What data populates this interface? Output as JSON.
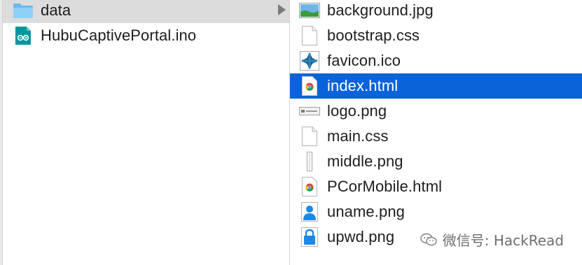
{
  "left_column": {
    "items": [
      {
        "name": "data",
        "icon": "folder-icon",
        "has_children": true,
        "state": "open"
      },
      {
        "name": "HubuCaptivePortal.ino",
        "icon": "arduino-file-icon"
      }
    ]
  },
  "right_column": {
    "items": [
      {
        "name": "background.jpg",
        "icon": "image-file-icon"
      },
      {
        "name": "bootstrap.css",
        "icon": "blank-document-icon"
      },
      {
        "name": "favicon.ico",
        "icon": "ico-file-icon"
      },
      {
        "name": "index.html",
        "icon": "chrome-html-file-icon",
        "selected": true
      },
      {
        "name": "logo.png",
        "icon": "png-thumbnail-icon"
      },
      {
        "name": "main.css",
        "icon": "blank-document-icon"
      },
      {
        "name": "middle.png",
        "icon": "thin-png-thumbnail-icon"
      },
      {
        "name": "PCorMobile.html",
        "icon": "chrome-html-file-icon"
      },
      {
        "name": "uname.png",
        "icon": "user-png-icon"
      },
      {
        "name": "upwd.png",
        "icon": "lock-png-icon"
      }
    ]
  },
  "watermark": {
    "text": "微信号: HackRead",
    "icon": "wechat-icon"
  },
  "colors": {
    "selection": "#0a63d9",
    "open_folder_row": "#dcdcdc",
    "folder_blue": "#7cc3f2",
    "arduino_teal": "#00979c"
  }
}
